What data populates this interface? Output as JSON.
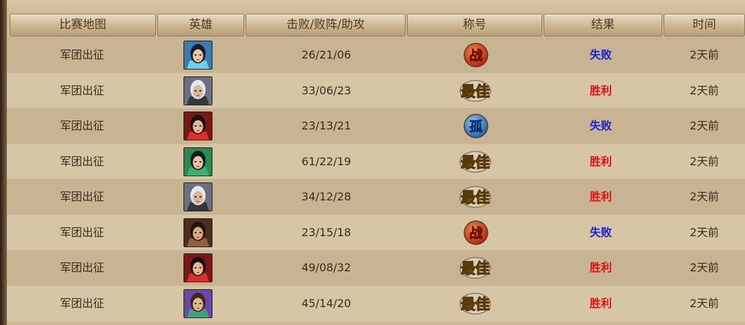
{
  "headers": {
    "map": "比赛地图",
    "hero": "英雄",
    "kda": "击败/败阵/助攻",
    "title": "称号",
    "result": "结果",
    "time": "时间"
  },
  "rows": [
    {
      "map": "军团出征",
      "hero": "hero-portrait-1",
      "kda": "26/21/06",
      "badge": "战",
      "badge_type": "zhan",
      "result": "失败",
      "outcome": "lose",
      "time": "2天前"
    },
    {
      "map": "军团出征",
      "hero": "hero-portrait-2",
      "kda": "33/06/23",
      "badge": "最佳",
      "badge_type": "best",
      "result": "胜利",
      "outcome": "win",
      "time": "2天前"
    },
    {
      "map": "军团出征",
      "hero": "hero-portrait-3",
      "kda": "23/13/21",
      "badge": "孤",
      "badge_type": "gu",
      "result": "失败",
      "outcome": "lose",
      "time": "2天前"
    },
    {
      "map": "军团出征",
      "hero": "hero-portrait-4",
      "kda": "61/22/19",
      "badge": "最佳",
      "badge_type": "best",
      "result": "胜利",
      "outcome": "win",
      "time": "2天前"
    },
    {
      "map": "军团出征",
      "hero": "hero-portrait-2",
      "kda": "34/12/28",
      "badge": "最佳",
      "badge_type": "best",
      "result": "胜利",
      "outcome": "win",
      "time": "2天前"
    },
    {
      "map": "军团出征",
      "hero": "hero-portrait-5",
      "kda": "23/15/18",
      "badge": "战",
      "badge_type": "zhan",
      "result": "失败",
      "outcome": "lose",
      "time": "2天前"
    },
    {
      "map": "军团出征",
      "hero": "hero-portrait-3",
      "kda": "49/08/32",
      "badge": "最佳",
      "badge_type": "best",
      "result": "胜利",
      "outcome": "win",
      "time": "2天前"
    },
    {
      "map": "军团出征",
      "hero": "hero-portrait-6",
      "kda": "45/14/20",
      "badge": "最佳",
      "badge_type": "best",
      "result": "胜利",
      "outcome": "win",
      "time": "2天前"
    }
  ],
  "colors": {
    "win": "#e01010",
    "lose": "#1a20d8",
    "zhan_badge": "#c0301a",
    "gu_badge": "#2f74c8",
    "best_badge": "#e8b428"
  }
}
